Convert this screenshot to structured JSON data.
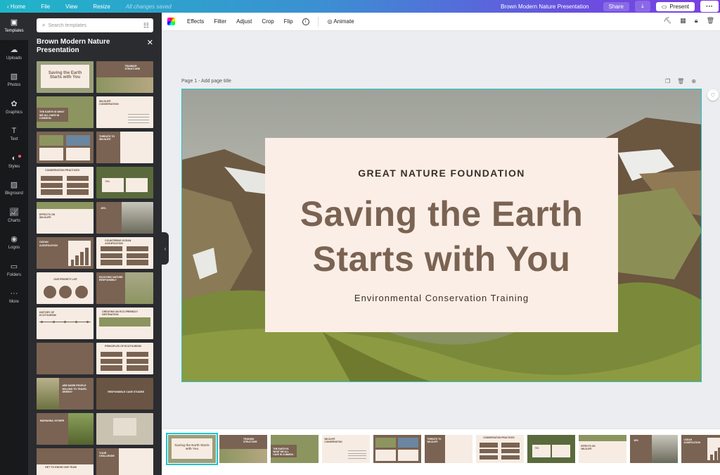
{
  "topbar": {
    "home": "Home",
    "file": "File",
    "view": "View",
    "resize": "Resize",
    "saved_status": "All changes saved",
    "doc_title": "Brown Modern Nature Presentation",
    "share": "Share",
    "present": "Present",
    "more": "···"
  },
  "rail": [
    {
      "label": "Templates",
      "icon": "template-icon"
    },
    {
      "label": "Uploads",
      "icon": "upload-icon"
    },
    {
      "label": "Photos",
      "icon": "photo-icon"
    },
    {
      "label": "Graphics",
      "icon": "graphics-icon"
    },
    {
      "label": "Text",
      "icon": "text-icon"
    },
    {
      "label": "Styles",
      "icon": "styles-icon"
    },
    {
      "label": "Bkground",
      "icon": "background-icon"
    },
    {
      "label": "Charts",
      "icon": "chart-icon"
    },
    {
      "label": "Logos",
      "icon": "logo-icon"
    },
    {
      "label": "Folders",
      "icon": "folder-icon"
    },
    {
      "label": "More",
      "icon": "more-icon"
    }
  ],
  "panel": {
    "search_placeholder": "Search templates",
    "title": "Brown Modern Nature Presentation"
  },
  "thumbnails": [
    {
      "label": "Saving the Earth Starts with You",
      "style": "title"
    },
    {
      "label": "TRAINING STRUCTURE",
      "style": "brown-photo"
    },
    {
      "label": "The Earth is what we all have in common.",
      "style": "photo-brown"
    },
    {
      "label": "WILDLIFE CONSERVATION",
      "style": "cream-text"
    },
    {
      "label": "",
      "style": "brown-two-photos"
    },
    {
      "label": "THREATS TO WILDLIFE",
      "style": "brown-left"
    },
    {
      "label": "Conservation Practices",
      "style": "cream-boxes"
    },
    {
      "label": "75%",
      "style": "forest-stats"
    },
    {
      "label": "EFFECTS ON WILDLIFE",
      "style": "cream-photo-top"
    },
    {
      "label": "26%",
      "style": "brown-rock"
    },
    {
      "label": "OCEAN ACIDIFICATION",
      "style": "brown-bars"
    },
    {
      "label": "Countering Ocean Acidification",
      "style": "cream-boxes2"
    },
    {
      "label": "OUR PRIORITY LIST",
      "style": "cream-circles"
    },
    {
      "label": "ENJOYING NATURE RESPONSIBLY",
      "style": "brown-photo-right"
    },
    {
      "label": "HISTORY OF ECOTOURISM",
      "style": "cream-timeline"
    },
    {
      "label": "Creating an Eco-Friendly Destination",
      "style": "cream-photos"
    },
    {
      "label": "",
      "style": "brown-plain"
    },
    {
      "label": "PRINCIPLES OF ECOTOURISM",
      "style": "cream-boxes3"
    },
    {
      "label": "ARE MORE PEOPLE WILLING TO TRAVEL GREEN?",
      "style": "photo-left-brown"
    },
    {
      "label": "Responsible Case Studies",
      "style": "brown-video"
    },
    {
      "label": "MARIANNA JOYNER",
      "style": "brown-photo-green"
    },
    {
      "label": "",
      "style": "mist-photo"
    },
    {
      "label": "GET TO KNOW OUR TEAM",
      "style": "brown-team"
    },
    {
      "label": "YOUR CHALLENGE",
      "style": "brown-cream"
    }
  ],
  "toolbar": {
    "effects": "Effects",
    "filter": "Filter",
    "adjust": "Adjust",
    "crop": "Crop",
    "flip": "Flip",
    "animate": "Animate"
  },
  "page": {
    "label": "Page 1 - Add page title"
  },
  "slide": {
    "org": "GREAT NATURE FOUNDATION",
    "headline_line1": "Saving the Earth",
    "headline_line2": "Starts with You",
    "subtitle": "Environmental Conservation Training"
  },
  "colors": {
    "accent": "#22c3cf",
    "brown": "#7a6352",
    "cream": "#fbeee6"
  },
  "filmstrip": [
    {
      "label": "Saving the Earth Starts with You",
      "style": "title"
    },
    {
      "label": "TRAINING STRUCTURE",
      "style": "brown-photo"
    },
    {
      "label": "The Earth is what we all have in common.",
      "style": "photo-brown"
    },
    {
      "label": "WILDLIFE CONSERVATION",
      "style": "cream-text"
    },
    {
      "label": "",
      "style": "brown-two-photos"
    },
    {
      "label": "THREATS TO WILDLIFE",
      "style": "brown-left"
    },
    {
      "label": "Conservation Practices",
      "style": "cream-boxes"
    },
    {
      "label": "75%",
      "style": "forest-stats"
    },
    {
      "label": "EFFECTS ON WILDLIFE",
      "style": "cream-photo-top"
    },
    {
      "label": "26%",
      "style": "brown-rock"
    },
    {
      "label": "OCEAN ACIDIFICATION",
      "style": "brown-bars"
    }
  ]
}
